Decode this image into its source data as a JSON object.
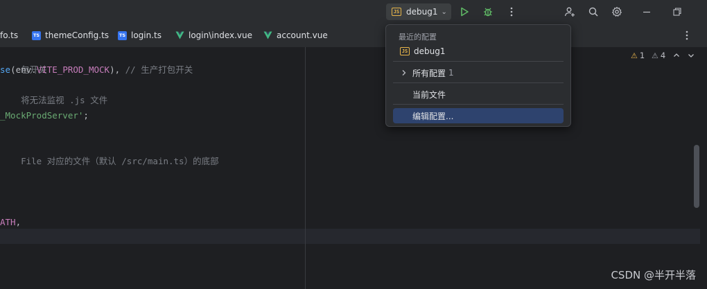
{
  "toolbar": {
    "run_config_name": "debug1",
    "run_config_icon": "js-file-icon",
    "icons": [
      "run-icon",
      "debug-icon",
      "more-vertical-icon",
      "add-user-icon",
      "search-icon",
      "settings-gear-icon",
      "minimize-icon",
      "restore-icon",
      "close-icon"
    ]
  },
  "tabs": [
    {
      "label": "fo.ts",
      "type": "ts"
    },
    {
      "label": "themeConfig.ts",
      "type": "ts"
    },
    {
      "label": "login.ts",
      "type": "ts"
    },
    {
      "label": "login\\index.vue",
      "type": "vue"
    },
    {
      "label": "account.vue",
      "type": "vue"
    }
  ],
  "inspections": {
    "warnings_a": "1",
    "warnings_b": "4"
  },
  "code": {
    "line1_comment": "包开关",
    "line2_fn": "se",
    "line2_open": "(env.",
    "line2_const": "VITE_PROD_MOCK",
    "line2_close": "), ",
    "line2_comment": "// 生产打包开关",
    "line3_comment": "将无法监视 .js 文件",
    "line4_str": "_MockProdServer'",
    "line4_end": ";",
    "line5_comment": "File 对应的文件（默认 /src/main.ts）的底部",
    "line6_const": "ATH",
    "line6_end": ","
  },
  "popup": {
    "header": "最近的配置",
    "recent_item": "debug1",
    "all_configs_label": "所有配置",
    "all_configs_count": "1",
    "current_file": "当前文件",
    "edit_configs": "编辑配置..."
  },
  "watermark": "CSDN @半开半落",
  "colors": {
    "accent": "#3574f0",
    "selection": "#2e436e",
    "run_green": "#5fb865",
    "warning": "#e9b44c"
  }
}
